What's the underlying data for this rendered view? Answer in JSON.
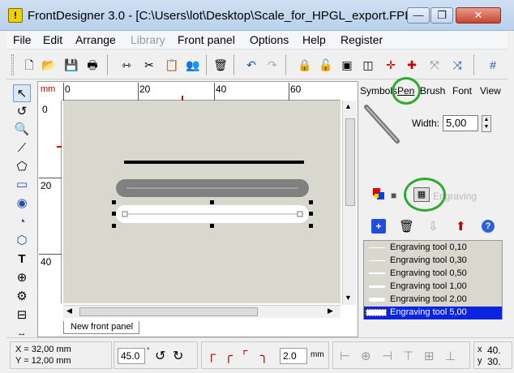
{
  "window": {
    "title": "FrontDesigner 3.0 - [C:\\Users\\lot\\Desktop\\Scale_for_HPGL_export.FPL]",
    "logo_text": "!",
    "minimize": "—",
    "maximize": "❐",
    "close": "✕"
  },
  "menu": [
    "File",
    "Edit",
    "Arrange",
    "Library",
    "Front panel",
    "Options",
    "Help",
    "Register"
  ],
  "ruler": {
    "unit": "mm",
    "h_labels": [
      "0",
      "20",
      "40",
      "60"
    ],
    "v_labels": [
      "0",
      "20",
      "40"
    ]
  },
  "tab": {
    "label": "New front panel"
  },
  "right_panel": {
    "tabs": [
      "Symbols",
      "Pen",
      "Brush",
      "Font",
      "View"
    ],
    "active_tab": "Pen",
    "width_label": "Width:",
    "width_value": "5,00",
    "fill_label": "Engraving",
    "tools": [
      {
        "label": "Engraving tool 0,10",
        "thickness": 1
      },
      {
        "label": "Engraving tool 0,30",
        "thickness": 1
      },
      {
        "label": "Engraving tool 0,50",
        "thickness": 2
      },
      {
        "label": "Engraving tool 1,00",
        "thickness": 3
      },
      {
        "label": "Engraving tool 2,00",
        "thickness": 5
      },
      {
        "label": "Engraving tool 5,00",
        "thickness": 8,
        "selected": true
      }
    ]
  },
  "status": {
    "x": "X = 32,00 mm",
    "y": "Y = 12,00 mm",
    "angle": "45.0",
    "angle_unit": "°",
    "corner_value": "2.0",
    "corner_unit": "mm",
    "right_x_label": "x",
    "right_y_label": "y",
    "right_x_value": "40.",
    "right_y_value": "30."
  },
  "colors": {
    "highlight_circle": "#2eab2e",
    "selection": "#0a24e0",
    "panel_bg": "#d8d8cf"
  }
}
